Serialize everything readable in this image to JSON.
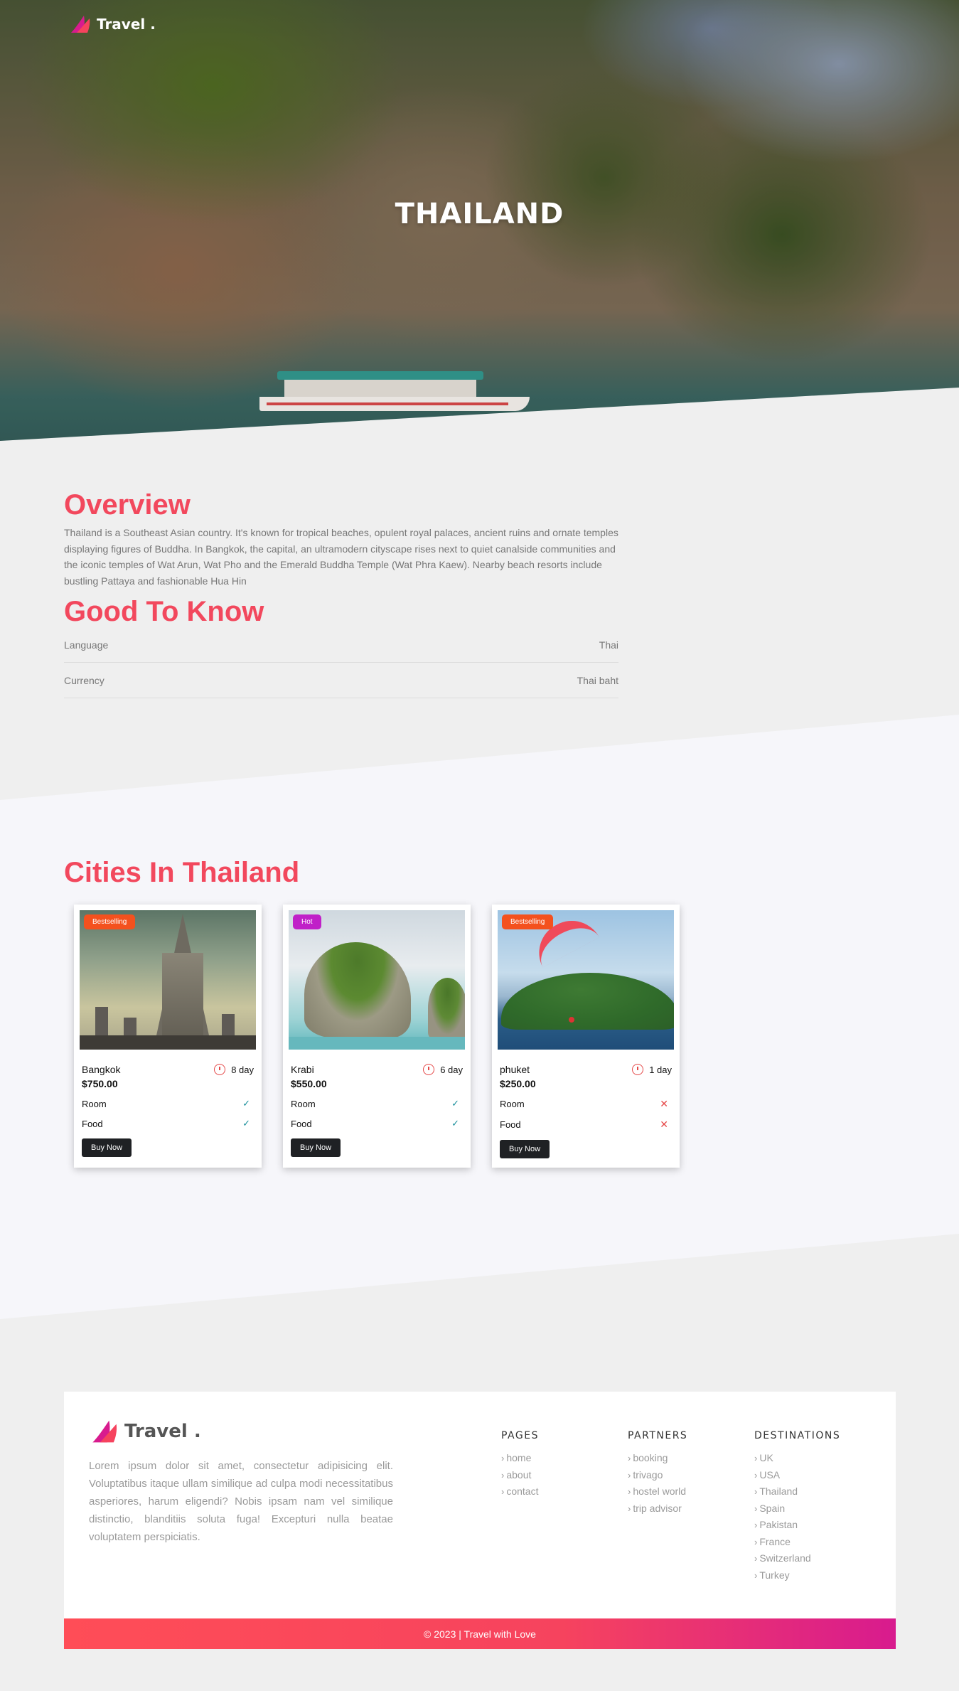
{
  "brand": {
    "name": "Travel",
    "dot": "."
  },
  "hero": {
    "title": "THAILAND"
  },
  "overview": {
    "heading": "Overview",
    "text": "Thailand is a Southeast Asian country. It's known for tropical beaches, opulent royal palaces, ancient ruins and ornate temples displaying figures of Buddha. In Bangkok, the capital, an ultramodern cityscape rises next to quiet canalside communities and the iconic temples of Wat Arun, Wat Pho and the Emerald Buddha Temple (Wat Phra Kaew). Nearby beach resorts include bustling Pattaya and fashionable Hua Hin"
  },
  "good_to_know": {
    "heading": "Good To Know",
    "items": [
      {
        "label": "Language",
        "value": "Thai"
      },
      {
        "label": "Currency",
        "value": "Thai baht"
      }
    ]
  },
  "cities": {
    "heading": "Cities In Thailand",
    "cards": [
      {
        "badge": "Bestselling",
        "name": "Bangkok",
        "duration": "8 day",
        "price": "$750.00",
        "room_label": "Room",
        "room": true,
        "food_label": "Food",
        "food": true,
        "button": "Buy Now"
      },
      {
        "badge": "Hot",
        "name": "Krabi",
        "duration": "6 day",
        "price": "$550.00",
        "room_label": "Room",
        "room": true,
        "food_label": "Food",
        "food": true,
        "button": "Buy Now"
      },
      {
        "badge": "Bestselling",
        "name": "phuket",
        "duration": "1 day",
        "price": "$250.00",
        "room_label": "Room",
        "room": false,
        "food_label": "Food",
        "food": false,
        "button": "Buy Now"
      }
    ]
  },
  "footer": {
    "description": "Lorem ipsum dolor sit amet, consectetur adipisicing elit. Voluptatibus itaque ullam similique ad culpa modi necessitatibus asperiores, harum eligendi? Nobis ipsam nam vel similique distinctio, blanditiis soluta fuga! Excepturi nulla beatae voluptatem perspiciatis.",
    "pages": {
      "title": "PAGES",
      "links": [
        "home",
        "about",
        "contact"
      ]
    },
    "partners": {
      "title": "PARTNERS",
      "links": [
        "booking",
        "trivago",
        "hostel world",
        "trip advisor"
      ]
    },
    "destinations": {
      "title": "DESTINATIONS",
      "links": [
        "UK",
        "USA",
        "Thailand",
        "Spain",
        "Pakistan",
        "France",
        "Switzerland",
        "Turkey"
      ]
    },
    "copyright": "© 2023 | Travel with Love"
  },
  "colors": {
    "accent": "#f2485d",
    "badge_orange": "#f4511e",
    "badge_purple": "#c020c8",
    "check": "#1a8f9b",
    "cross": "#e54848"
  }
}
